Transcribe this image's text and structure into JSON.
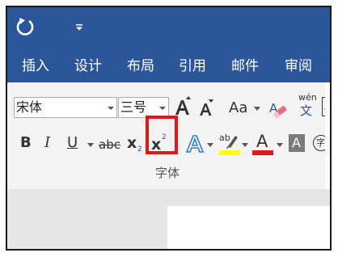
{
  "menu": {
    "items": [
      "插入",
      "设计",
      "布局",
      "引用",
      "邮件",
      "审阅"
    ]
  },
  "font": {
    "name_value": "宋体",
    "size_value": "三号",
    "aa_label": "Aa",
    "wen_pinyin": "wén",
    "wen_char": "文",
    "partial_letter": "A"
  },
  "format": {
    "bold": "B",
    "italic": "I",
    "underline": "U",
    "strike": "abc",
    "subscript_base": "x",
    "subscript_mark": "2",
    "superscript_base": "x",
    "superscript_mark": "2",
    "highlight_text": "ab",
    "font_color_letter": "A",
    "shading_letter": "A",
    "enclose_char": "字"
  },
  "group": {
    "label": "字体"
  },
  "colors": {
    "title_bar": "#2b579a",
    "highlight": "#ffff00",
    "font_color": "#e01818",
    "callout": "#e01818"
  }
}
